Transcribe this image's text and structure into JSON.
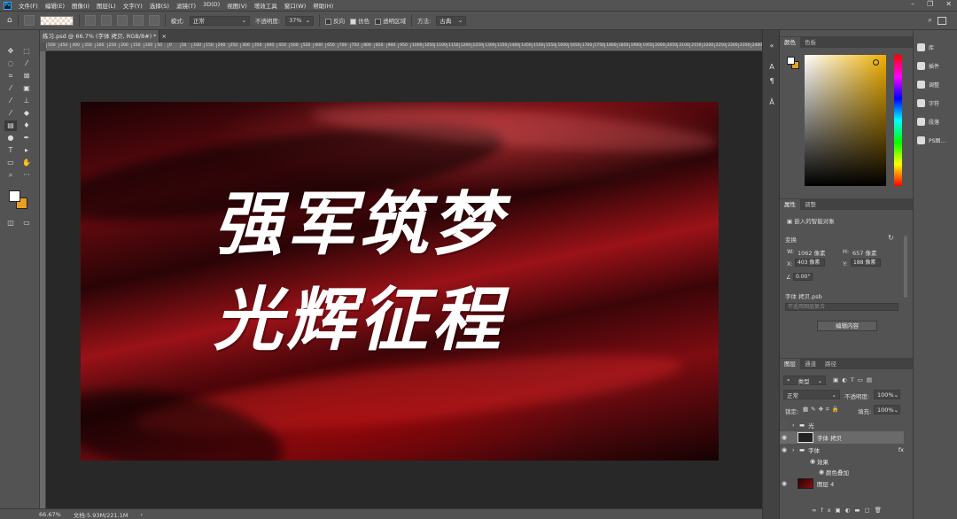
{
  "menu": {
    "items": [
      "文件(F)",
      "编辑(E)",
      "图像(I)",
      "图层(L)",
      "文字(Y)",
      "选择(S)",
      "滤镜(T)",
      "3D(D)",
      "视图(V)",
      "增效工具",
      "窗口(W)",
      "帮助(H)"
    ],
    "app_badge": "Ps"
  },
  "options": {
    "mode_label": "模式:",
    "mode_value": "正常",
    "opacity_label": "不透明度:",
    "opacity_value": "37%",
    "reverse_label": "反向",
    "dither_label": "仿色",
    "transparency_label": "透明区域",
    "method_label": "方法:",
    "method_value": "古典"
  },
  "document": {
    "tab_title": "练习.psd @ 66.7% (字体 拷贝, RGB/8#) *",
    "close_glyph": "×",
    "ruler_ticks": [
      "500",
      "450",
      "400",
      "350",
      "300",
      "250",
      "200",
      "150",
      "100",
      "50",
      "0",
      "50",
      "100",
      "150",
      "200",
      "250",
      "300",
      "350",
      "400",
      "450",
      "500",
      "550",
      "600",
      "650",
      "700",
      "750",
      "800",
      "850",
      "900",
      "950",
      "1000",
      "1050",
      "1100",
      "1150",
      "1200",
      "1250",
      "1300",
      "1350",
      "1400",
      "1450",
      "1500",
      "1550",
      "1600",
      "1650",
      "1700",
      "1750",
      "1800",
      "1850",
      "1900",
      "1950",
      "2000",
      "2050",
      "2100",
      "2150",
      "2200",
      "2250",
      "2300",
      "2350",
      "2400"
    ],
    "artwork_line1": "强军筑梦",
    "artwork_line2": "光辉征程"
  },
  "status": {
    "zoom": "66.67%",
    "doc_size": "文档:5.93M/221.1M",
    "arrow": "›"
  },
  "color_panel": {
    "tab_color": "颜色",
    "tab_swatches": "色板",
    "fg_color": "#ffffff",
    "bg_color": "#e8a020"
  },
  "properties": {
    "tab_props": "属性",
    "tab_adjust": "调整",
    "smart_object": "嵌入的智能对象",
    "transform": "变换",
    "w_label": "W:",
    "w_value": "1062 像素",
    "h_label": "H:",
    "h_value": "657 像素",
    "x_label": "X:",
    "x_value": "403 像素",
    "y_label": "Y:",
    "y_value": "188 像素",
    "angle_value": "0.00°",
    "file_name": "字体 拷贝.psb",
    "comps_placeholder": "不适用图层复合",
    "edit_button": "编辑内容"
  },
  "layers_panel": {
    "tab_layers": "图层",
    "tab_channels": "通道",
    "tab_paths": "路径",
    "filter_kind": "类型",
    "blend_mode": "正常",
    "opacity_label": "不透明度:",
    "opacity_value": "100%",
    "lock_label": "锁定:",
    "fill_label": "填充:",
    "fill_value": "100%",
    "fx_glyph": "fx",
    "layers": [
      {
        "name": "光",
        "kind": "group"
      },
      {
        "name": "字体 拷贝",
        "kind": "smart"
      },
      {
        "name": "字体",
        "kind": "group"
      },
      {
        "name": "效果",
        "kind": "effects"
      },
      {
        "name": "颜色叠加",
        "kind": "effect"
      },
      {
        "name": "图层 4",
        "kind": "pixel"
      }
    ]
  },
  "right_panels": [
    "库",
    "插件",
    "调整",
    "字符",
    "段落",
    "PS图..."
  ]
}
